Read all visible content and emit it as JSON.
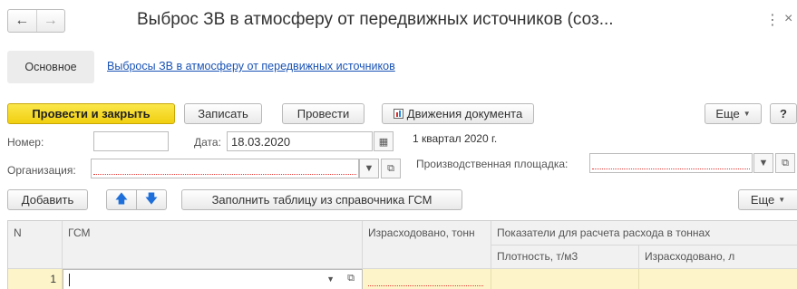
{
  "header": {
    "back_icon": "←",
    "forward_icon": "→",
    "title": "Выброс ЗВ в атмосферу от передвижных источников (соз...",
    "more_icon": "⋮",
    "close_icon": "×"
  },
  "tabs": {
    "main_label": "Основное",
    "link_label": "Выбросы ЗВ в атмосферу от передвижных источников"
  },
  "toolbar": {
    "post_close": "Провести и закрыть",
    "save": "Записать",
    "post": "Провести",
    "movements": "Движения документа",
    "more": "Еще",
    "help": "?"
  },
  "form": {
    "number_label": "Номер:",
    "number_value": "",
    "date_label": "Дата:",
    "date_value": "18.03.2020",
    "period_text": "1 квартал 2020 г.",
    "org_label": "Организация:",
    "org_value": "",
    "site_label": "Производственная площадка:",
    "site_value": ""
  },
  "table_toolbar": {
    "add": "Добавить",
    "fill": "Заполнить таблицу из справочника ГСМ",
    "more": "Еще"
  },
  "table": {
    "columns": {
      "n": "N",
      "gsm": "ГСМ",
      "spent_t": "Израсходовано, тонн",
      "group": "Показатели для расчета расхода в тоннах",
      "density": "Плотность, т/м3",
      "spent_l": "Израсходовано, л"
    },
    "rows": [
      {
        "n": "1",
        "gsm": "",
        "spent_t": "",
        "density": "",
        "spent_l": ""
      }
    ]
  }
}
